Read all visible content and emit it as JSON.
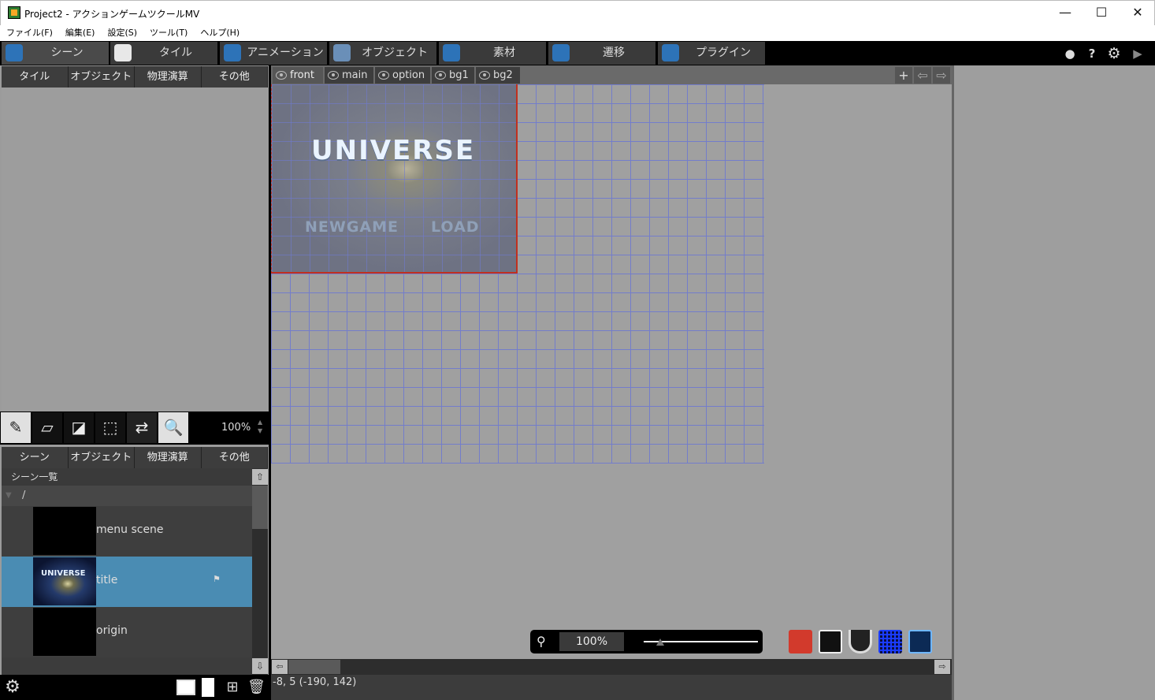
{
  "window": {
    "title": "Project2 - アクションゲームツクールMV",
    "controls": {
      "minimize": "—",
      "maximize": "☐",
      "close": "✕"
    }
  },
  "menu": [
    "ファイル(F)",
    "編集(E)",
    "設定(S)",
    "ツール(T)",
    "ヘルプ(H)"
  ],
  "toolbar": {
    "tabs": [
      {
        "label": "シーン",
        "icon": "scene-icon",
        "active": true
      },
      {
        "label": "タイル",
        "icon": "tile-icon"
      },
      {
        "label": "アニメーション",
        "icon": "animation-icon"
      },
      {
        "label": "オブジェクト",
        "icon": "object-icon"
      },
      {
        "label": "素材",
        "icon": "material-icon"
      },
      {
        "label": "遷移",
        "icon": "transition-icon"
      },
      {
        "label": "プラグイン",
        "icon": "plugin-icon"
      }
    ],
    "right_icons": {
      "record": "●",
      "help": "?",
      "settings": "⚙",
      "play": "▶"
    }
  },
  "palette_tabs": [
    "タイル",
    "オブジェクト",
    "物理演算",
    "その他"
  ],
  "edit_tools": {
    "icons": [
      "pencil-icon",
      "rect-fill-icon",
      "eraser-icon",
      "select-icon",
      "swap-view-icon",
      "zoom-icon"
    ],
    "glyphs": [
      "✎",
      "▱",
      "◪",
      "⬚",
      "⇄",
      "🔍"
    ],
    "zoom": "100%"
  },
  "lower_tabs": [
    "シーン",
    "オブジェクト",
    "物理演算",
    "その他"
  ],
  "scene_list": {
    "header": "シーン一覧",
    "folder": "/",
    "items": [
      {
        "name": "menu scene",
        "selected": false
      },
      {
        "name": "title",
        "selected": true,
        "thumb_text": "UNIVERSE"
      },
      {
        "name": "origin",
        "selected": false
      }
    ]
  },
  "layers": {
    "tabs": [
      "front",
      "main",
      "option",
      "bg1",
      "bg2"
    ],
    "active": "front",
    "add": "+"
  },
  "canvas": {
    "logo_text": "UNIVERSE",
    "menu_options": [
      "NEWGAME",
      "LOAD"
    ]
  },
  "zoom_bar": {
    "value": "100%",
    "level": 0.15
  },
  "canvas_tools": [
    "object-icon",
    "swap-view-icon",
    "magnet-icon",
    "grid-icon",
    "map-icon"
  ],
  "status": "-8, 5 (-190, 142)",
  "colors": {
    "selection": "#4a8cb3",
    "grid": "#6f7ad0",
    "scene_border": "#c0301f"
  }
}
